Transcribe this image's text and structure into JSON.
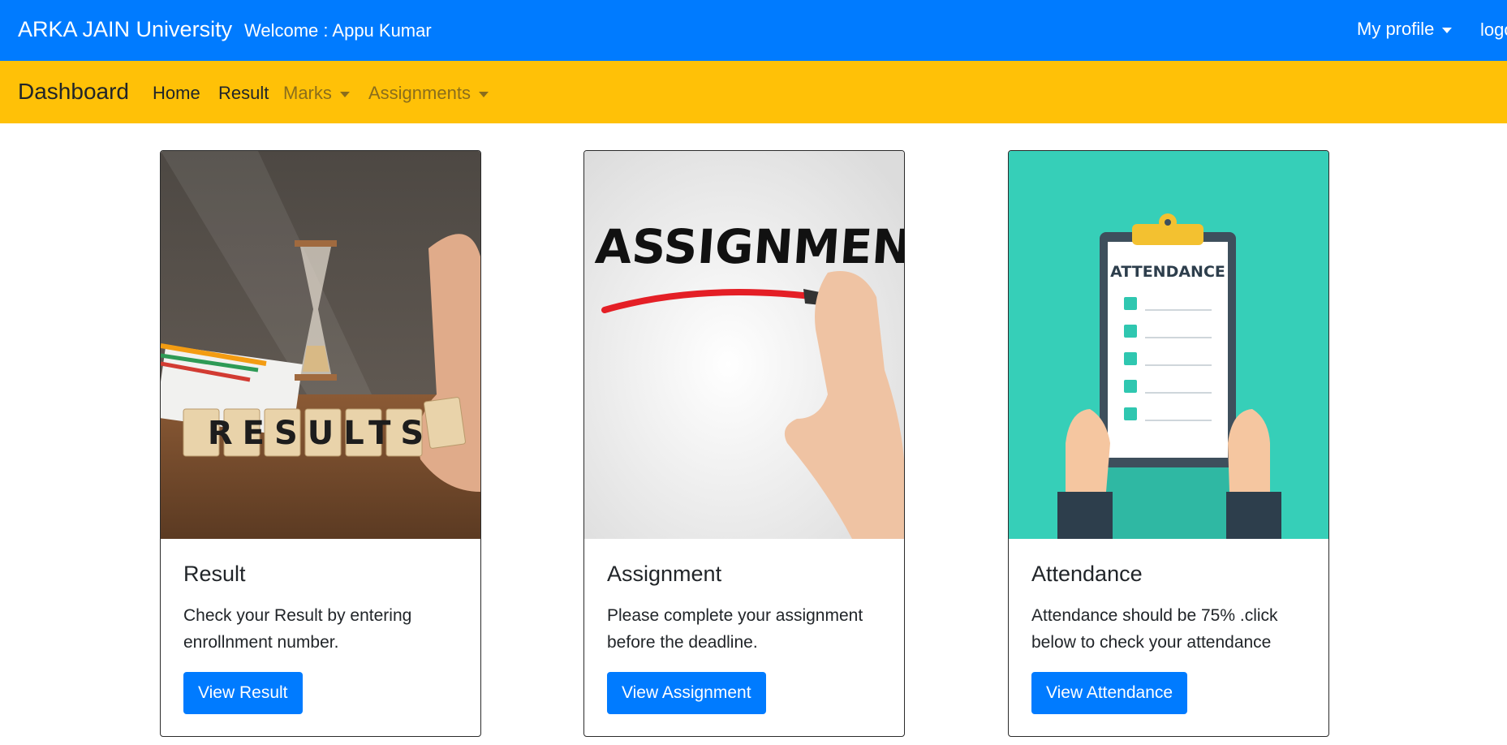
{
  "topbar": {
    "brand": "ARKA JAIN University",
    "welcome": "Welcome : Appu Kumar",
    "profile_label": "My profile",
    "logout_label": "logout"
  },
  "subnav": {
    "title": "Dashboard",
    "links": [
      "Home",
      "Result",
      "Marks",
      "Assignments"
    ]
  },
  "cards": [
    {
      "image_text": "RESULTS",
      "title": "Result",
      "text": "Check your Result by entering enrollnment number.",
      "button": "View Result"
    },
    {
      "image_text": "ASSIGNMENT",
      "title": "Assignment",
      "text": "Please complete your assignment before the deadline.",
      "button": "View Assignment"
    },
    {
      "image_text": "ATTENDANCE",
      "title": "Attendance",
      "text": "Attendance should be 75% .click below to check your attendance",
      "button": "View Attendance"
    }
  ],
  "colors": {
    "primary": "#007bff",
    "warning": "#ffc107",
    "attendance_bg": "#36cfb8"
  }
}
